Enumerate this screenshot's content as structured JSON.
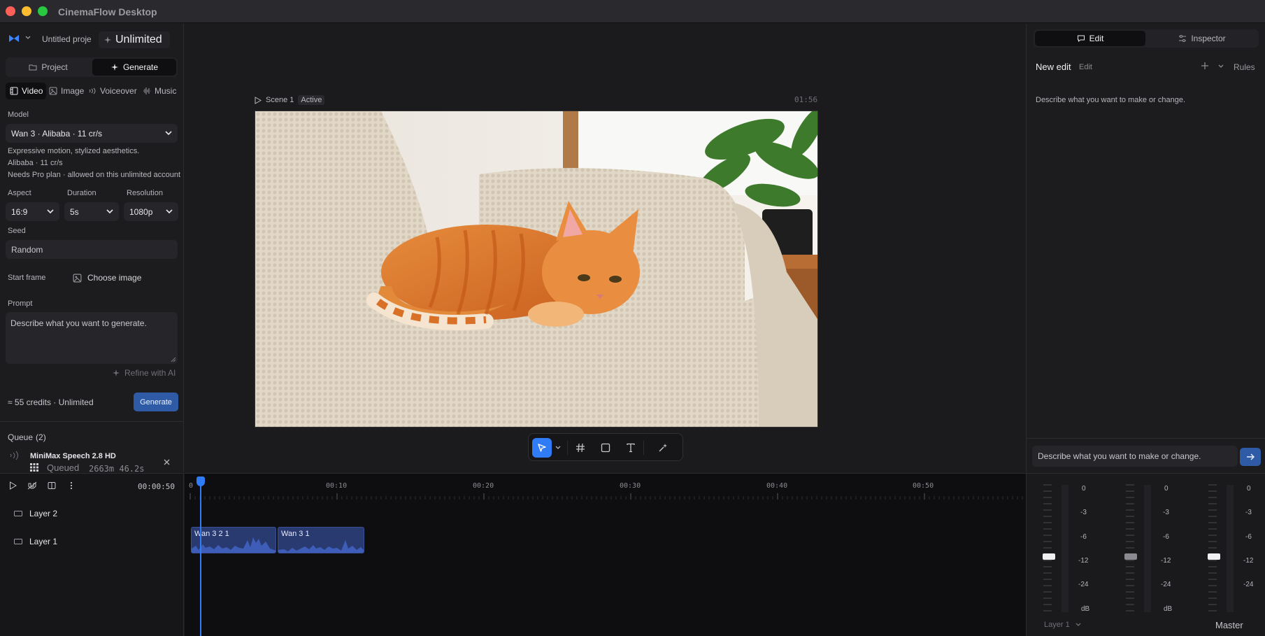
{
  "app": {
    "title": "CinemaFlow Desktop"
  },
  "left": {
    "project_name": "Untitled project",
    "plan_badge": "Unlimited",
    "mode_tabs": [
      {
        "label": "Project"
      },
      {
        "label": "Generate"
      }
    ],
    "type_tabs": [
      {
        "label": "Video"
      },
      {
        "label": "Image"
      },
      {
        "label": "Voiceover"
      },
      {
        "label": "Music"
      }
    ],
    "model": {
      "label": "Model",
      "value": "Wan 3 · Alibaba · 11 cr/s",
      "desc1": "Expressive motion, stylized aesthetics.",
      "desc2": "Alibaba · 11 cr/s",
      "desc3": "Needs Pro plan · allowed on this unlimited account"
    },
    "aspect": {
      "label": "Aspect",
      "value": "16:9"
    },
    "duration": {
      "label": "Duration",
      "value": "5s"
    },
    "resolution": {
      "label": "Resolution",
      "value": "1080p"
    },
    "seed": {
      "label": "Seed",
      "value": "Random"
    },
    "start_frame": {
      "label": "Start frame",
      "button": "Choose image"
    },
    "prompt": {
      "label": "Prompt",
      "placeholder": "Describe what you want to generate."
    },
    "refine_label": "Refine with AI",
    "credits_text": "≈ 55 credits · Unlimited",
    "generate_label": "Generate",
    "queue": {
      "title": "Queue",
      "count": "(2)",
      "item_title": "MiniMax Speech 2.8 HD",
      "item_status": "Queued",
      "item_meta": "2663m 46.2s"
    }
  },
  "viewer": {
    "scene_label": "Scene 1",
    "scene_status": "Active",
    "timecode": "01:56"
  },
  "right": {
    "tabs": [
      {
        "label": "Edit"
      },
      {
        "label": "Inspector"
      }
    ],
    "new_edit": "New edit",
    "edit_tag": "Edit",
    "rules": "Rules",
    "hint": "Describe what you want to make or change.",
    "input_placeholder": "Describe what you want to make or change."
  },
  "timeline": {
    "timecode": "00:00:50",
    "ruler": [
      "0",
      "00:10",
      "00:20",
      "00:30",
      "00:40",
      "00:50"
    ],
    "layers": [
      {
        "label": "Layer 2"
      },
      {
        "label": "Layer 1"
      }
    ],
    "clips": [
      {
        "label": "Wan 3 2 1"
      },
      {
        "label": "Wan 3 1"
      }
    ],
    "playhead_seconds": 0.5
  },
  "mixer": {
    "db_scale": [
      "0",
      "-3",
      "-6",
      "-12",
      "-24",
      "dB"
    ],
    "layer_select": "Layer 1",
    "master": "Master"
  },
  "colors": {
    "accent": "#2f7cf6",
    "clip": "#283a70"
  }
}
